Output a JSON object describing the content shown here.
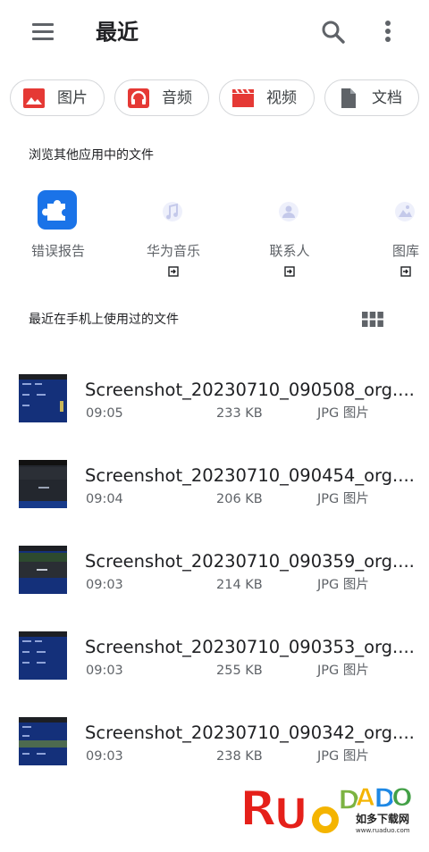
{
  "header": {
    "title": "最近",
    "menu_icon": "menu-icon",
    "search_icon": "search-icon",
    "more_icon": "more-vert-icon"
  },
  "chips": [
    {
      "label": "图片",
      "icon": "image-icon",
      "color": "#e53935"
    },
    {
      "label": "音频",
      "icon": "headphones-icon",
      "color": "#e53935"
    },
    {
      "label": "视频",
      "icon": "movie-icon",
      "color": "#e53935"
    },
    {
      "label": "文档",
      "icon": "document-icon",
      "color": "#5f6368"
    }
  ],
  "other_apps": {
    "title": "浏览其他应用中的文件",
    "apps": [
      {
        "label": "错误报告",
        "icon": "puzzle-icon",
        "color": "#1a73e8"
      },
      {
        "label": "华为音乐",
        "icon": "music-app-icon"
      },
      {
        "label": "联系人",
        "icon": "contacts-app-icon"
      },
      {
        "label": "图库",
        "icon": "gallery-app-icon"
      }
    ]
  },
  "recent": {
    "title": "最近在手机上使用过的文件",
    "view_toggle_icon": "grid-view-icon",
    "files": [
      {
        "name": "Screenshot_20230710_090508_org....",
        "time": "09:05",
        "size": "233 KB",
        "type": "JPG 图片"
      },
      {
        "name": "Screenshot_20230710_090454_org....",
        "time": "09:04",
        "size": "206 KB",
        "type": "JPG 图片"
      },
      {
        "name": "Screenshot_20230710_090359_org....",
        "time": "09:03",
        "size": "214 KB",
        "type": "JPG 图片"
      },
      {
        "name": "Screenshot_20230710_090353_org....",
        "time": "09:03",
        "size": "255 KB",
        "type": "JPG 图片"
      },
      {
        "name": "Screenshot_20230710_090342_org....",
        "time": "09:03",
        "size": "238 KB",
        "type": "JPG 图片"
      }
    ]
  },
  "watermark": {
    "logo": "RUANDADO",
    "subtitle": "如多下载网",
    "url": "www.ruaduo.com"
  }
}
